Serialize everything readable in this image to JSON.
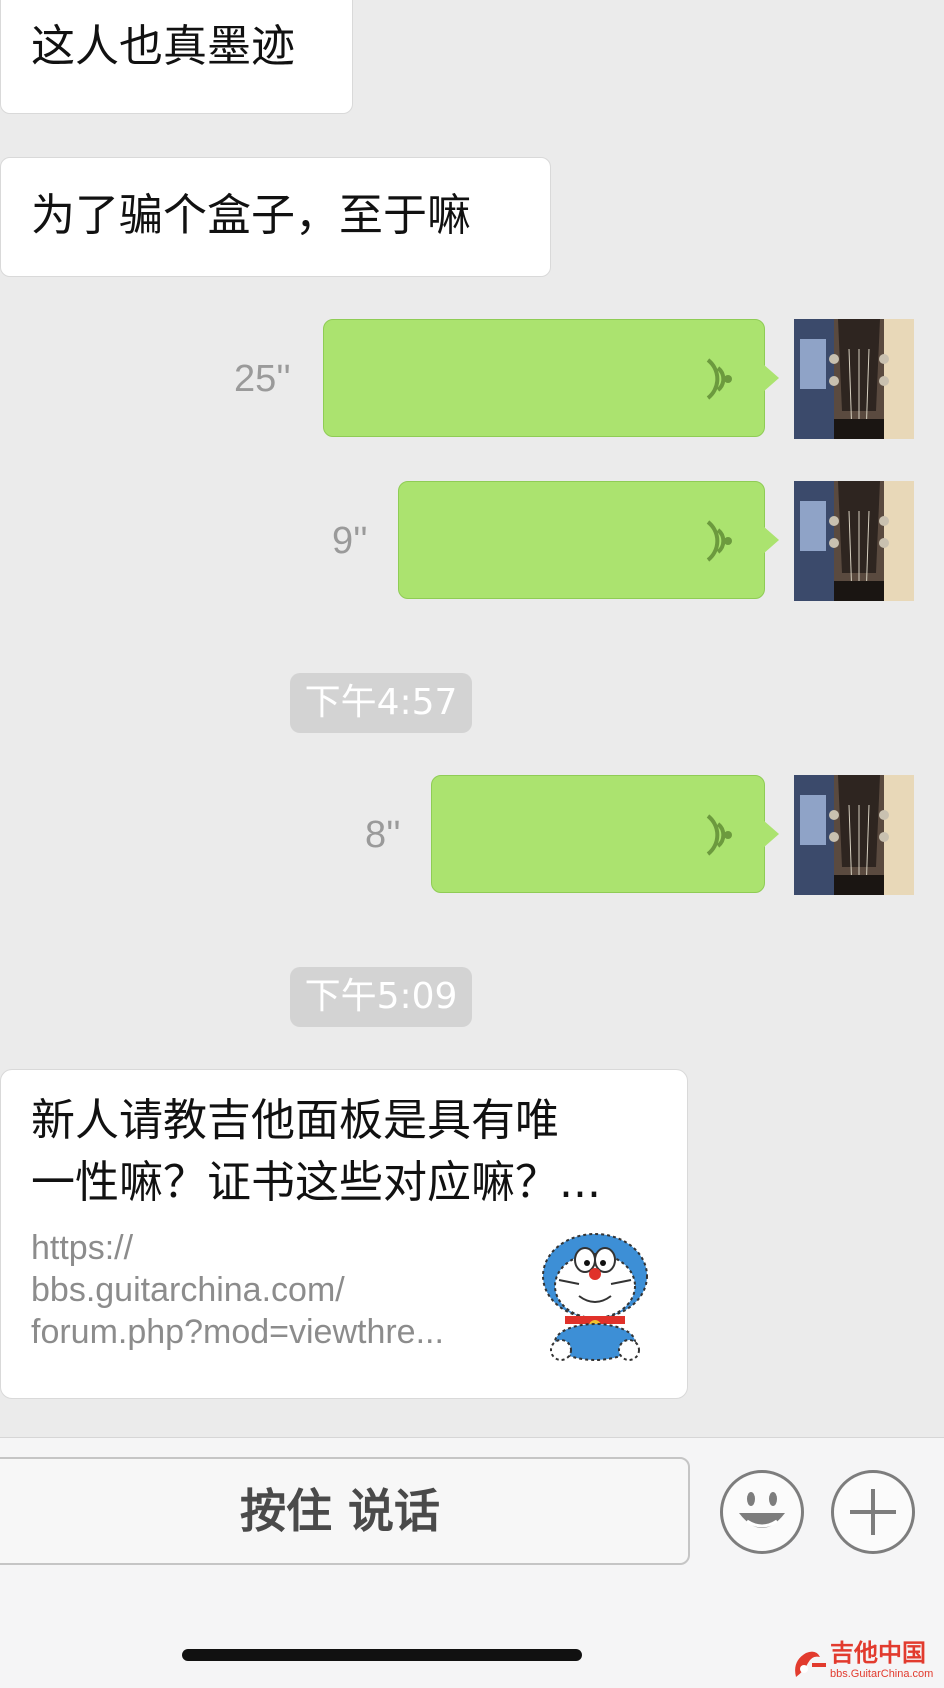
{
  "messages": {
    "incoming_1": "这人也真墨迹",
    "incoming_2": "为了骗个盒子，至于嘛"
  },
  "voice_messages": [
    {
      "duration": "25''"
    },
    {
      "duration": "9''"
    },
    {
      "duration": "8''"
    }
  ],
  "timestamps": [
    "下午4:57",
    "下午5:09"
  ],
  "link_card": {
    "title_line1": "新人请教吉他面板是具有唯",
    "title_line2": "一性嘛？证书这些对应嘛？...",
    "url_line1": "https://",
    "url_line2": "bbs.guitarchina.com/",
    "url_line3": "forum.php?mod=viewthre..."
  },
  "input_bar": {
    "hold_to_talk": "按住 说话",
    "emoji_icon": "smiley-face-icon",
    "more_icon": "plus-icon"
  },
  "watermark": {
    "brand": "吉他中国",
    "site": "bbs.GuitarChina.com"
  },
  "colors": {
    "chat_bg": "#ebebeb",
    "voice_bubble": "#abe36f",
    "incoming_bubble": "#ffffff",
    "timestamp_bg": "#d3d3d3",
    "watermark_red": "#e23b2e"
  }
}
